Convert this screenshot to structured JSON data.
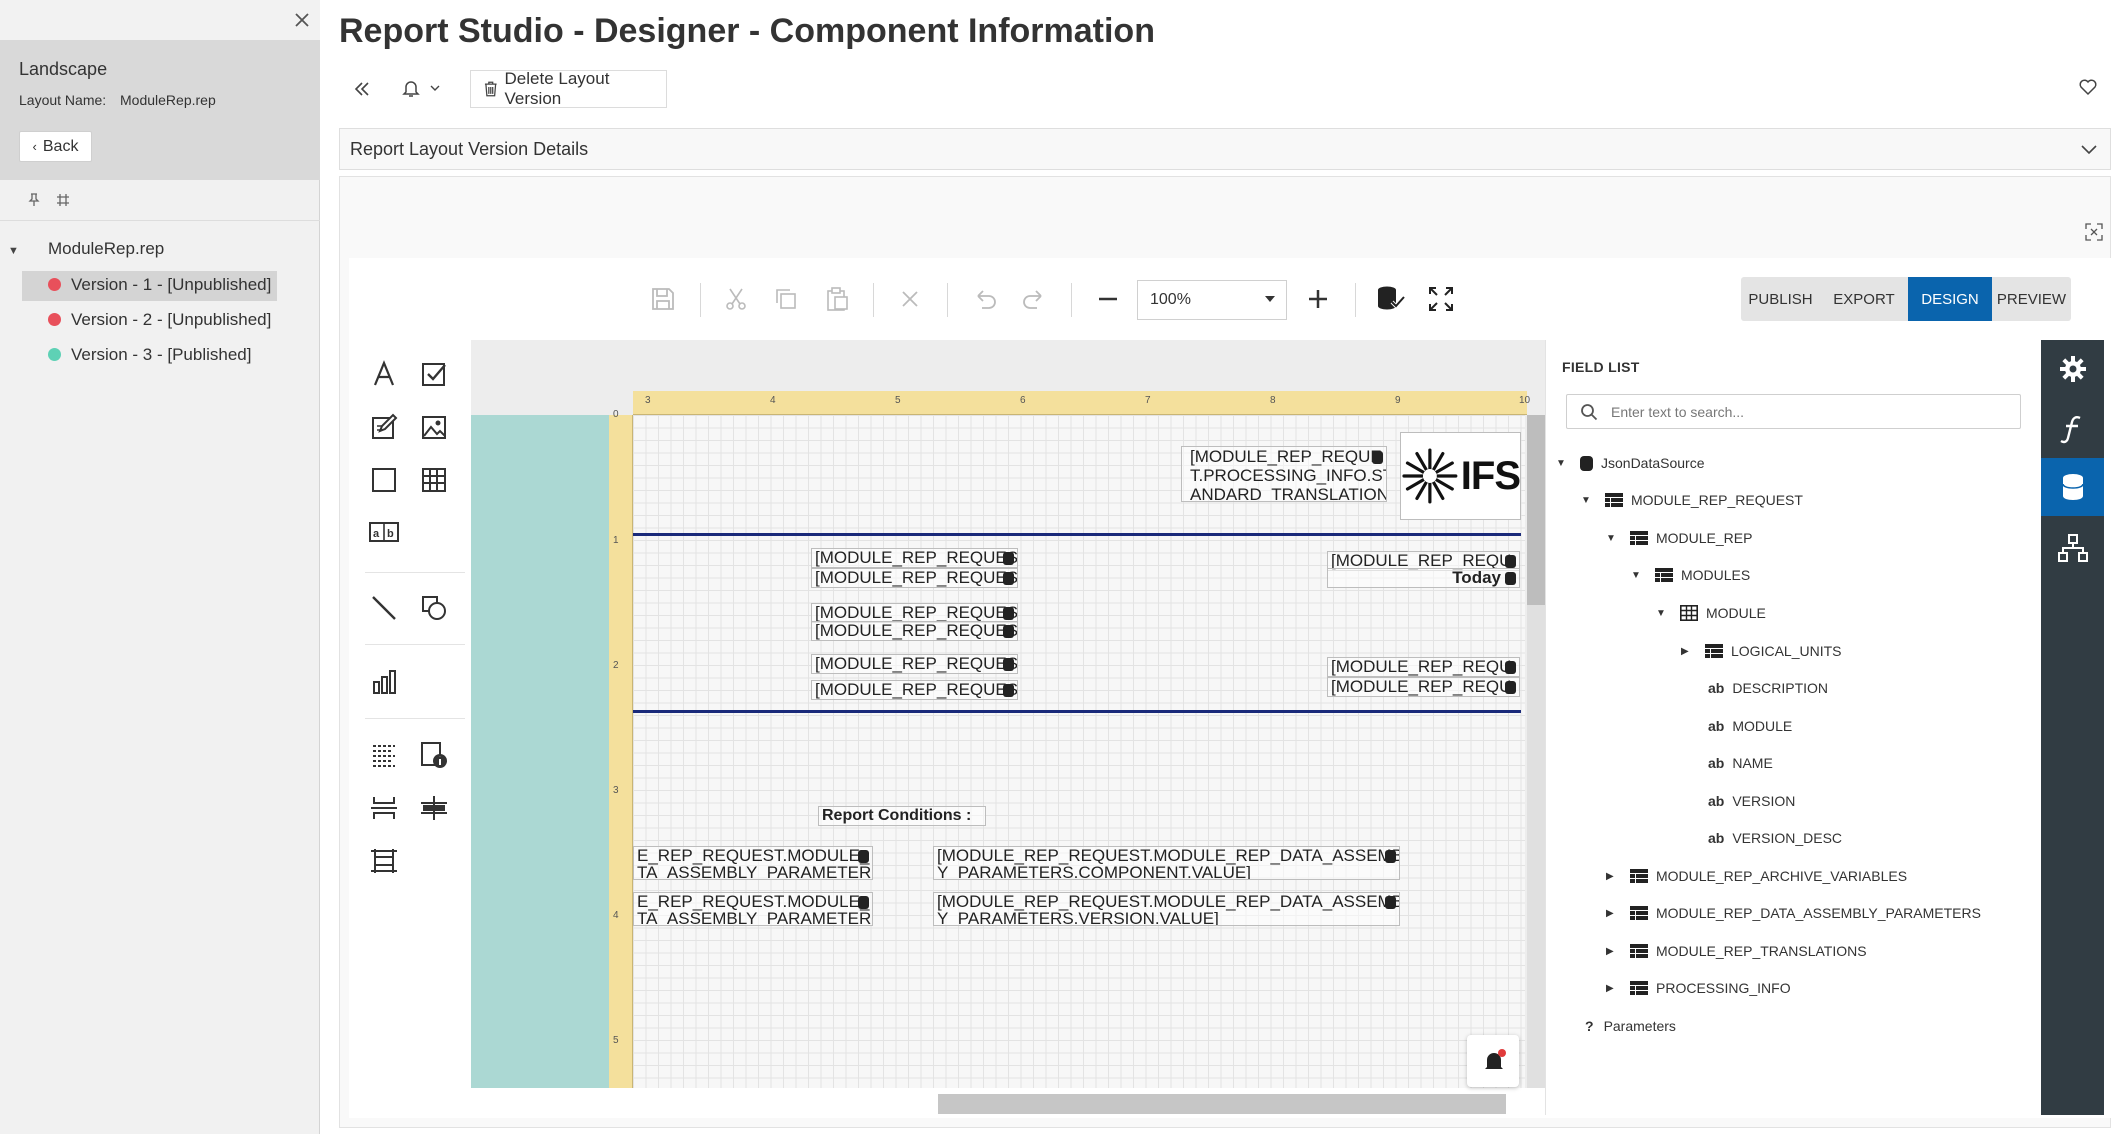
{
  "left_panel": {
    "title": "Landscape",
    "layout_name_label": "Layout Name:",
    "layout_name_value": "ModuleRep.rep",
    "back_label": "Back",
    "tree_root": "ModuleRep.rep",
    "versions": [
      {
        "label": "Version - 1 - [Unpublished]",
        "status_color": "#e8505b"
      },
      {
        "label": "Version - 2 - [Unpublished]",
        "status_color": "#e8505b"
      },
      {
        "label": "Version - 3 - [Published]",
        "status_color": "#5ed1b5"
      }
    ]
  },
  "header": {
    "title": "Report Studio - Designer - Component Information",
    "delete_label": "Delete Layout Version",
    "details_label": "Report Layout Version Details"
  },
  "toolbar": {
    "zoom_value": "100%",
    "modes": [
      "PUBLISH",
      "EXPORT",
      "DESIGN",
      "PREVIEW"
    ],
    "active_mode": "DESIGN"
  },
  "canvas": {
    "ruler_h": [
      "3",
      "4",
      "5",
      "6",
      "7",
      "8",
      "9",
      "10"
    ],
    "ruler_v": [
      "0",
      "1",
      "2",
      "3",
      "4",
      "5"
    ],
    "logo_text": "IFS",
    "fields": {
      "header_l1": "[MODULE_REP_REQUE",
      "header_l2": "T.PROCESSING_INFO.ST",
      "header_l3": "ANDARD_TRANSLATION",
      "f1": "[MODULE_REP_REQUES",
      "f2": "[MODULE_REP_REQUES",
      "f3": "[MODULE_REP_REQUES",
      "f4": "[MODULE_REP_REQUES",
      "f5": "[MODULE_REP_REQUES",
      "f6": "[MODULE_REP_REQUES",
      "r1": "[MODULE_REP_REQU",
      "today": "Today",
      "r2": "[MODULE_REP_REQU",
      "r3": "[MODULE_REP_REQU",
      "conditions": "Report Conditions :",
      "c1a": "E_REP_REQUEST.MODULE_",
      "c1a2": "TA_ASSEMBLY_PARAMETERS",
      "c1b": "[MODULE_REP_REQUEST.MODULE_REP_DATA_ASSEMB",
      "c1b2": "Y_PARAMETERS.COMPONENT.VALUE]",
      "c2a": "E_REP_REQUEST.MODULE_",
      "c2a2": "TA_ASSEMBLY_PARAMETERS",
      "c2b": "[MODULE_REP_REQUEST.MODULE_REP_DATA_ASSEMB",
      "c2b2": "Y_PARAMETERS.VERSION.VALUE]"
    }
  },
  "field_list": {
    "title": "FIELD LIST",
    "search_placeholder": "Enter text to search...",
    "nodes": {
      "n0": "JsonDataSource",
      "n1": "MODULE_REP_REQUEST",
      "n2": "MODULE_REP",
      "n3": "MODULES",
      "n4": "MODULE",
      "n5": "LOGICAL_UNITS",
      "n6": "DESCRIPTION",
      "n7": "MODULE",
      "n8": "NAME",
      "n9": "VERSION",
      "n10": "VERSION_DESC",
      "n11": "MODULE_REP_ARCHIVE_VARIABLES",
      "n12": "MODULE_REP_DATA_ASSEMBLY_PARAMETERS",
      "n13": "MODULE_REP_TRANSLATIONS",
      "n14": "PROCESSING_INFO",
      "n15": "Parameters"
    },
    "ab_glyph": "ab",
    "param_glyph": "?"
  },
  "colors": {
    "accent": "#0a64ad",
    "dark_sidebar": "#313c43",
    "teal_margin": "#abd8d3",
    "ruler": "#f4e09c"
  }
}
